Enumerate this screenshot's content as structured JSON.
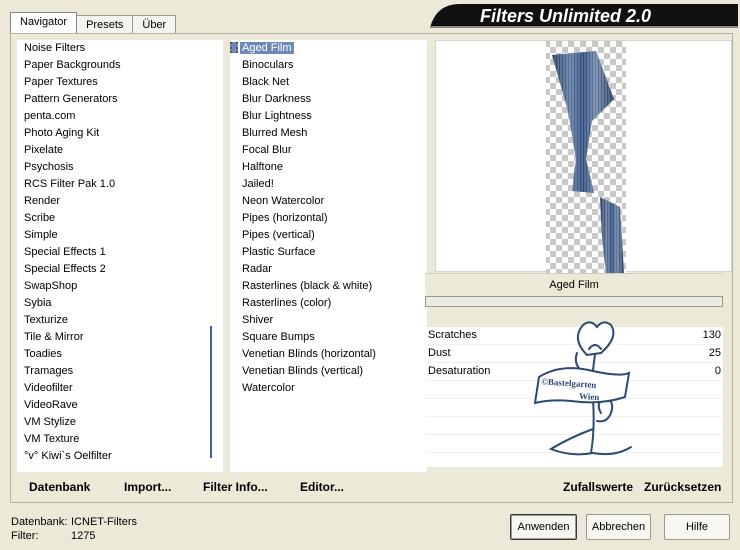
{
  "tabs": [
    "Navigator",
    "Presets",
    "Über"
  ],
  "banner_title": "Filters Unlimited 2.0",
  "categories": [
    "Noise Filters",
    "Paper Backgrounds",
    "Paper Textures",
    "Pattern Generators",
    "penta.com",
    "Photo Aging Kit",
    "Pixelate",
    "Psychosis",
    "RCS Filter Pak 1.0",
    "Render",
    "Scribe",
    "Simple",
    "Special Effects 1",
    "Special Effects 2",
    "SwapShop",
    "Sybia",
    "Texturize",
    "Tile & Mirror",
    "Toadies",
    "Tramages",
    "Videofilter",
    "VideoRave",
    "VM Stylize",
    "VM Texture",
    "°v° Kiwi`s Oelfilter"
  ],
  "selected_category": "Special Effects 1",
  "filters": [
    "Aged Film",
    "Binoculars",
    "Black Net",
    "Blur Darkness",
    "Blur Lightness",
    "Blurred Mesh",
    "Focal Blur",
    "Halftone",
    "Jailed!",
    "Neon Watercolor",
    "Pipes (horizontal)",
    "Pipes (vertical)",
    "Plastic Surface",
    "Radar",
    "Rasterlines (black & white)",
    "Rasterlines (color)",
    "Shiver",
    "Square Bumps",
    "Venetian Blinds (horizontal)",
    "Venetian Blinds (vertical)",
    "Watercolor"
  ],
  "selected_filter": "Aged Film",
  "preview_filter_name": "Aged Film",
  "progress": 0,
  "params": [
    {
      "label": "Scratches",
      "value": "130"
    },
    {
      "label": "Dust",
      "value": "25"
    },
    {
      "label": "Desaturation",
      "value": "0"
    }
  ],
  "watermark": {
    "line1": "©Bastelgarten",
    "line2": "Wien"
  },
  "bottom_links": {
    "datenbank": "Datenbank",
    "import": "Import...",
    "filter_info": "Filter Info...",
    "editor": "Editor...",
    "zufallswerte": "Zufallswerte",
    "zuruecksetzen": "Zurücksetzen"
  },
  "status": {
    "datenbank_label": "Datenbank:",
    "datenbank_value": "ICNET-Filters",
    "filter_label": "Filter:",
    "filter_value": "1275"
  },
  "buttons": {
    "apply": "Anwenden",
    "cancel": "Abbrechen",
    "help": "Hilfe"
  },
  "colors": {
    "selection": "#6f88b8",
    "banner": "#111111",
    "preview_stripe": "#2a4a7a"
  }
}
